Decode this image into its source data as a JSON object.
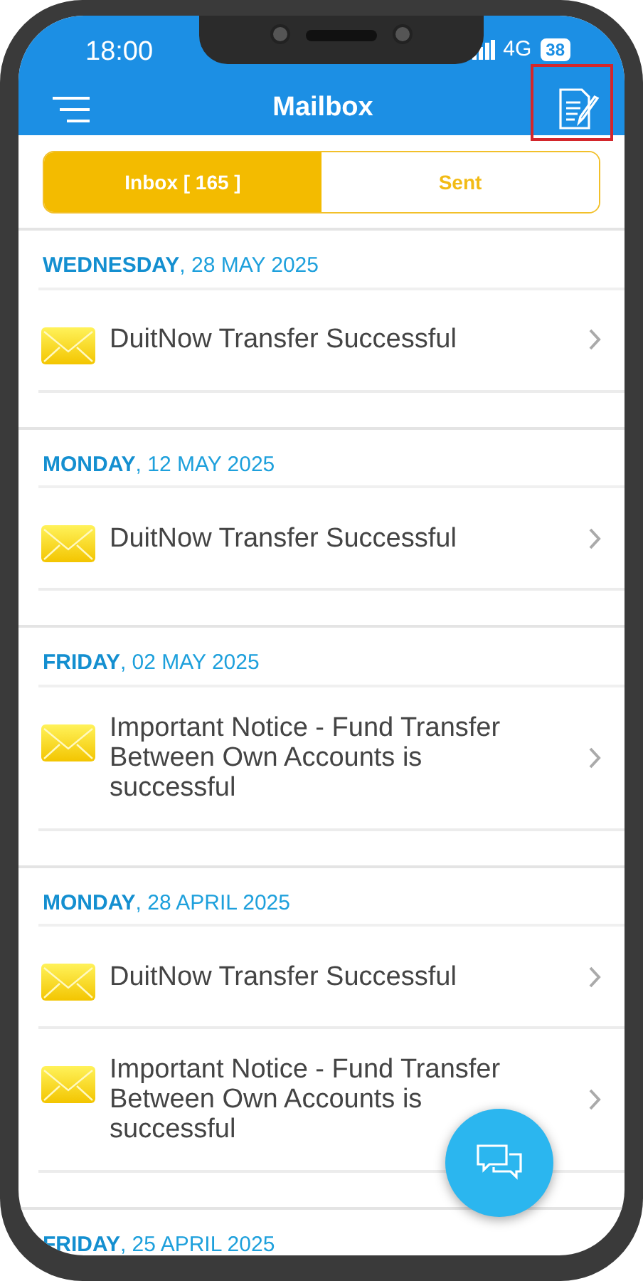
{
  "status_bar": {
    "time": "18:00",
    "network": "4G",
    "battery": "38"
  },
  "header": {
    "title": "Mailbox"
  },
  "tabs": [
    {
      "label": "Inbox [ 165 ]",
      "selected": true
    },
    {
      "label": "Sent",
      "selected": false
    }
  ],
  "groups": [
    {
      "date": "**WEDNESDAY**, 28 MAY 2025",
      "messages": [
        {
          "subject": "DuitNow Transfer Successful"
        }
      ]
    },
    {
      "date": "**MONDAY**, 12 MAY 2025",
      "messages": [
        {
          "subject": "DuitNow Transfer Successful"
        }
      ]
    },
    {
      "date": "**FRIDAY**, 02 MAY 2025",
      "messages": [
        {
          "subject": "Important Notice - Fund Transfer Between Own Accounts is successful"
        }
      ]
    },
    {
      "date": "**MONDAY**, 28 APRIL 2025",
      "messages": [
        {
          "subject": "DuitNow Transfer Successful"
        },
        {
          "subject": "Important Notice - Fund Transfer Between Own Accounts is successful"
        }
      ]
    },
    {
      "date": "**FRIDAY**, 25 APRIL 2025"
    }
  ]
}
